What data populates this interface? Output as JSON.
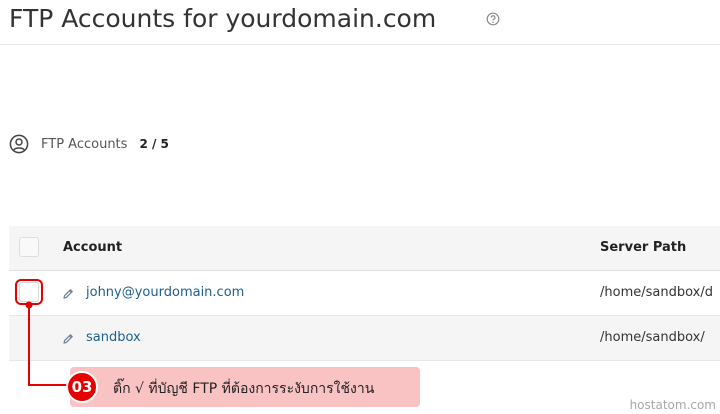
{
  "header": {
    "title": "FTP Accounts for yourdomain.com",
    "help_icon": "question-circle-icon"
  },
  "summary": {
    "icon": "user-circle-icon",
    "label": "FTP Accounts",
    "value": "2 / 5"
  },
  "table": {
    "columns": [
      "Account",
      "Server Path"
    ],
    "rows": [
      {
        "account": "johny@yourdomain.com",
        "path": "/home/sandbox/d",
        "edit_icon": "pencil-icon",
        "checked": false,
        "highlighted": true
      },
      {
        "account": "sandbox",
        "path": "/home/sandbox/",
        "edit_icon": "pencil-icon",
        "checked": false,
        "highlighted": false
      }
    ]
  },
  "annotation": {
    "step": "03",
    "text": "ติ๊ก √ ที่บัญชี FTP ที่ต้องการระงับการใช้งาน",
    "color": "#e60000"
  },
  "watermark": "hostatom.com"
}
